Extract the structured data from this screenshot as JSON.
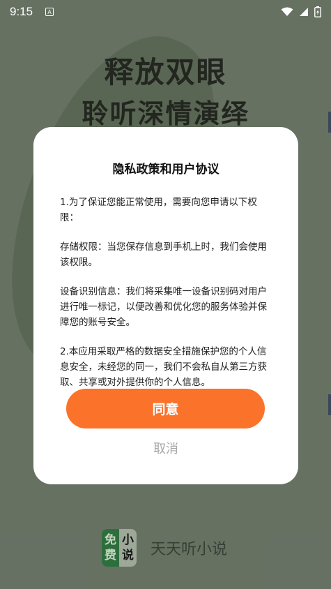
{
  "status_bar": {
    "time": "9:15",
    "notification_badge": "A",
    "icons": [
      "wifi-icon",
      "signal-icon",
      "battery-charging-icon"
    ]
  },
  "background": {
    "headline_line1": "释放双眼",
    "headline_line2": "聆听深情演绎",
    "brand_logo_left": [
      "免",
      "费"
    ],
    "brand_logo_right": [
      "小",
      "说"
    ],
    "brand_name": "天天听小说"
  },
  "dialog": {
    "title": "隐私政策和用户协议",
    "paragraphs": [
      "1.为了保证您能正常使用，需要向您申请以下权限：",
      "存储权限：当您保存信息到手机上时，我们会使用该权限。",
      "设备识别信息：我们将采集唯一设备识别码对用户进行唯一标记，以便改善和优化您的服务体验并保障您的账号安全。",
      "2.本应用采取严格的数据安全措施保护您的个人信息安全，未经您的同一，我们不会私自从第三方获取、共享或对外提供你的个人信息。"
    ],
    "agree_label": "同意",
    "cancel_label": "取消"
  },
  "colors": {
    "accent": "#fb722a",
    "cancel_text": "#a7a7a7",
    "background": "#717d6d"
  }
}
